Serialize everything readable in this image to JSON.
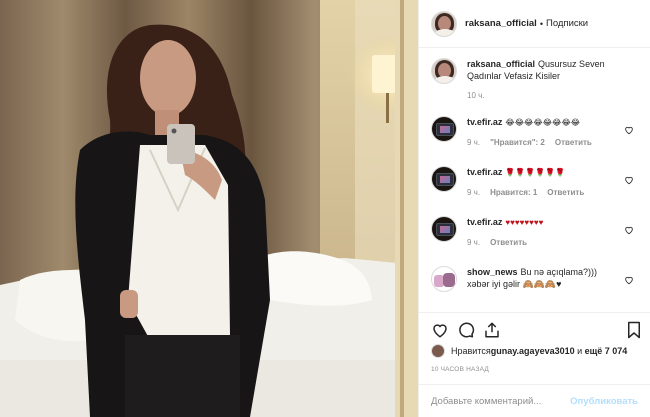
{
  "header": {
    "username": "raksana_official",
    "separator": "•",
    "follow_status": "Подписки"
  },
  "caption": {
    "username": "raksana_official",
    "text": "Qusursuz Seven Qadınlar Vefasiz Kisiler",
    "time": "10 ч."
  },
  "comments": [
    {
      "username": "tv.efir.az",
      "text": "😂😂😂😂😂😂😂😂",
      "time": "9 ч.",
      "likes": "\"Нравится\": 2",
      "reply": "Ответить"
    },
    {
      "username": "tv.efir.az",
      "text": "🌹🌹🌹🌹🌹🌹",
      "time": "9 ч.",
      "likes": "Нравится: 1",
      "reply": "Ответить"
    },
    {
      "username": "tv.efir.az",
      "text": "♥♥♥♥♥♥♥♥",
      "time": "9 ч.",
      "reply": "Ответить"
    },
    {
      "username": "show_news",
      "text": "Bu nə açıqlama?)))",
      "text2": "xəbər iyi gəlir 🙈🙈🙈♥"
    }
  ],
  "likes": {
    "prefix": "Нравится ",
    "user": "gunay.agayeva3010",
    "middle": " и ",
    "rest": "ещё 7 074"
  },
  "timestamp": "10 часов назад",
  "add_comment": {
    "placeholder": "Добавьте комментарий...",
    "publish_label": "Опубликовать"
  },
  "icons": [
    "heart-icon",
    "comment-icon",
    "share-icon",
    "bookmark-icon"
  ],
  "colors": {
    "link_disabled": "#b2dffc",
    "secondary_text": "#8e8e8e",
    "border": "#efefef"
  }
}
